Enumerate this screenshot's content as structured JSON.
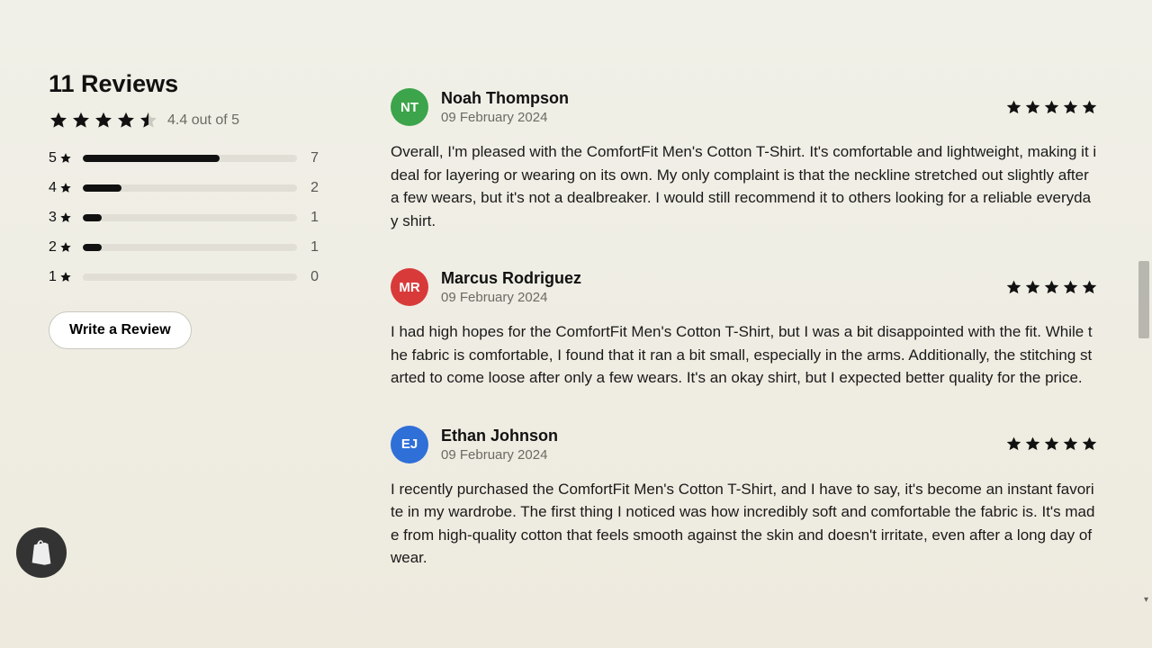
{
  "summary": {
    "heading": "11 Reviews",
    "avg_text": "4.4 out of 5",
    "avg_value": 4.4,
    "total": 11,
    "distribution": [
      {
        "label": "5",
        "count": 7,
        "pct": 64
      },
      {
        "label": "4",
        "count": 2,
        "pct": 18
      },
      {
        "label": "3",
        "count": 1,
        "pct": 9
      },
      {
        "label": "2",
        "count": 1,
        "pct": 9
      },
      {
        "label": "1",
        "count": 0,
        "pct": 0
      }
    ],
    "write_label": "Write a Review"
  },
  "reviews": [
    {
      "initials": "NT",
      "avatar_color": "#3ca44a",
      "name": "Noah Thompson",
      "date": "09 February 2024",
      "stars": 5,
      "body": "Overall, I'm pleased with the ComfortFit Men's Cotton T-Shirt. It's comfortable and lightweight, making it ideal for layering or wearing on its own. My only complaint is that the neckline stretched out slightly after a few wears, but it's not a dealbreaker. I would still recommend it to others looking for a reliable everyday shirt."
    },
    {
      "initials": "MR",
      "avatar_color": "#d83a3a",
      "name": "Marcus Rodriguez",
      "date": "09 February 2024",
      "stars": 5,
      "body": "I had high hopes for the ComfortFit Men's Cotton T-Shirt, but I was a bit disappointed with the fit. While the fabric is comfortable, I found that it ran a bit small, especially in the arms. Additionally, the stitching started to come loose after only a few wears. It's an okay shirt, but I expected better quality for the price."
    },
    {
      "initials": "EJ",
      "avatar_color": "#2f6fd8",
      "name": "Ethan Johnson",
      "date": "09 February 2024",
      "stars": 5,
      "body": "I recently purchased the ComfortFit Men's Cotton T-Shirt, and I have to say, it's become an instant favorite in my wardrobe. The first thing I noticed was how incredibly soft and comfortable the fabric is. It's made from high-quality cotton that feels smooth against the skin and doesn't irritate, even after a long day of wear."
    }
  ]
}
